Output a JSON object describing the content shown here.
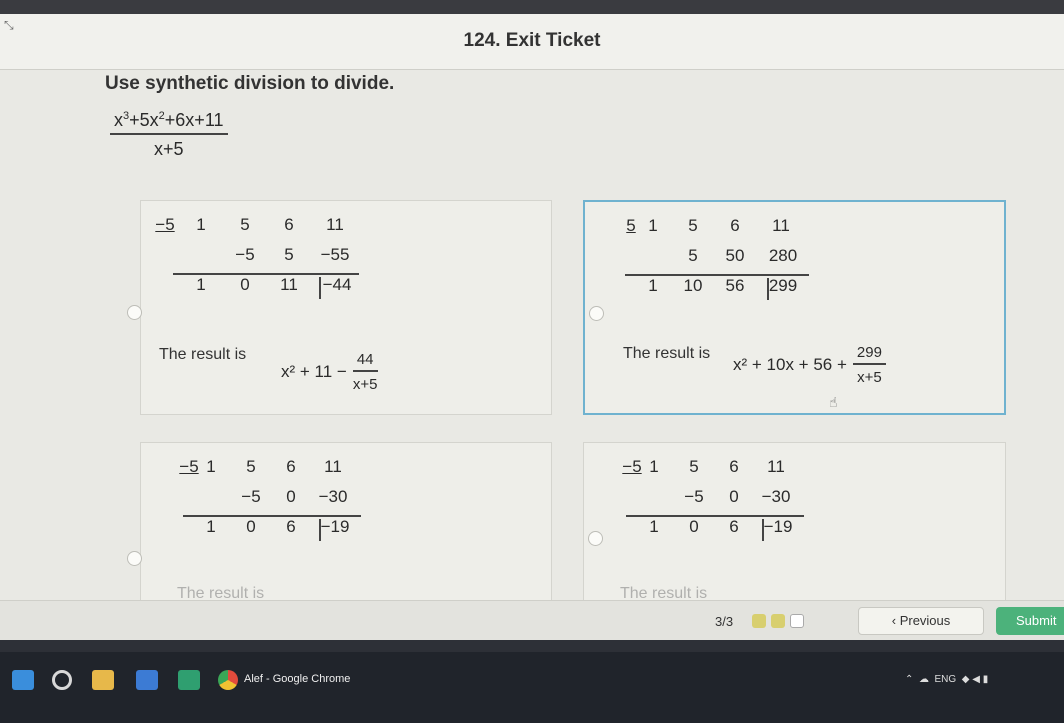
{
  "header": {
    "title": "124. Exit Ticket"
  },
  "question": {
    "instruction": "Use synthetic division to divide.",
    "numerator_parts": [
      "x",
      "3",
      "+5x",
      "2",
      "+6x+11"
    ],
    "denominator": "x+5"
  },
  "options": [
    {
      "root": "−5",
      "coeffs": [
        "1",
        "5",
        "6",
        "11"
      ],
      "middle": [
        "−5",
        "5",
        "−55"
      ],
      "bottom": [
        "1",
        "0",
        "11",
        "−44"
      ],
      "result_label": "The result is",
      "result_expr": "x² + 11 −",
      "result_frac_num": "44",
      "result_frac_den": "x+5",
      "selected": false
    },
    {
      "root": "5",
      "coeffs": [
        "1",
        "5",
        "6",
        "11"
      ],
      "middle": [
        "5",
        "50",
        "280"
      ],
      "bottom": [
        "1",
        "10",
        "56",
        "299"
      ],
      "result_label": "The result is",
      "result_expr": "x² + 10x + 56 +",
      "result_frac_num": "299",
      "result_frac_den": "x+5",
      "selected": true
    },
    {
      "root": "−5",
      "coeffs": [
        "1",
        "5",
        "6",
        "11"
      ],
      "middle": [
        "−5",
        "0",
        "−30"
      ],
      "bottom": [
        "1",
        "0",
        "6",
        "−19"
      ],
      "result_label": "The result is",
      "selected": false
    },
    {
      "root": "−5",
      "coeffs": [
        "1",
        "5",
        "6",
        "11"
      ],
      "middle": [
        "−5",
        "0",
        "−30"
      ],
      "bottom": [
        "1",
        "0",
        "6",
        "−19"
      ],
      "result_label": "The result is",
      "selected": false
    }
  ],
  "footer": {
    "page_indicator": "3/3",
    "previous_label": "Previous",
    "submit_label": "Submit"
  },
  "taskbar": {
    "chrome_label": "Alef - Google Chrome",
    "tray_text": "ENG"
  },
  "colors": {
    "selected_border": "#6fb2cf",
    "submit_green": "#4cb27b",
    "progress_dot": "#d8cf6f"
  }
}
